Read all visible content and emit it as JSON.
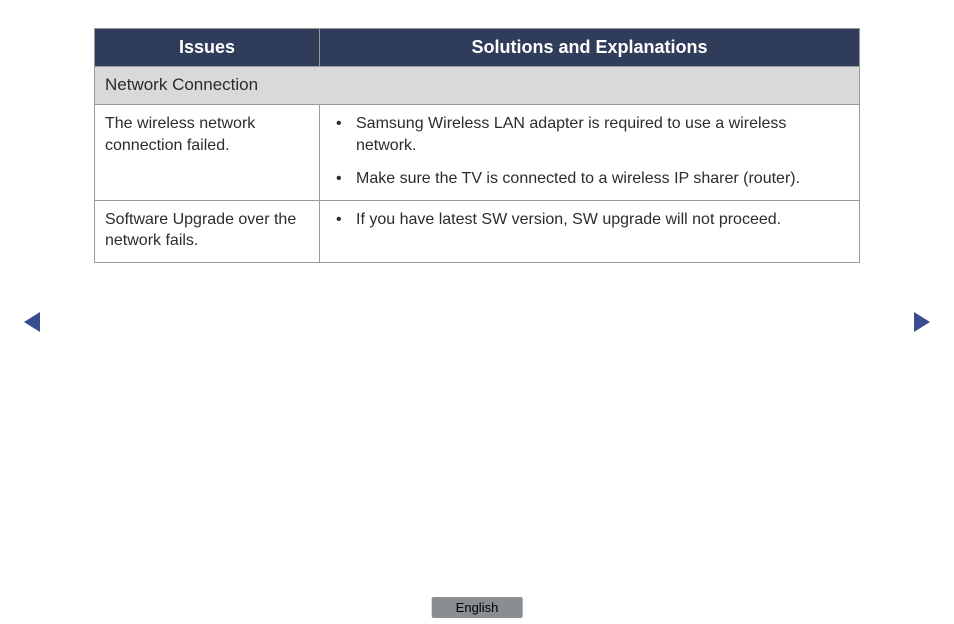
{
  "table": {
    "headers": {
      "issues": "Issues",
      "solutions": "Solutions and Explanations"
    },
    "section": "Network Connection",
    "rows": [
      {
        "issue": "The wireless network connection failed.",
        "solutions": [
          "Samsung Wireless LAN adapter is required to use a wireless network.",
          "Make sure the TV is connected to a wireless IP sharer (router)."
        ]
      },
      {
        "issue": "Software Upgrade over the network fails.",
        "solutions": [
          "If you have latest SW version, SW upgrade will not proceed."
        ]
      }
    ]
  },
  "footer": {
    "language": "English"
  }
}
